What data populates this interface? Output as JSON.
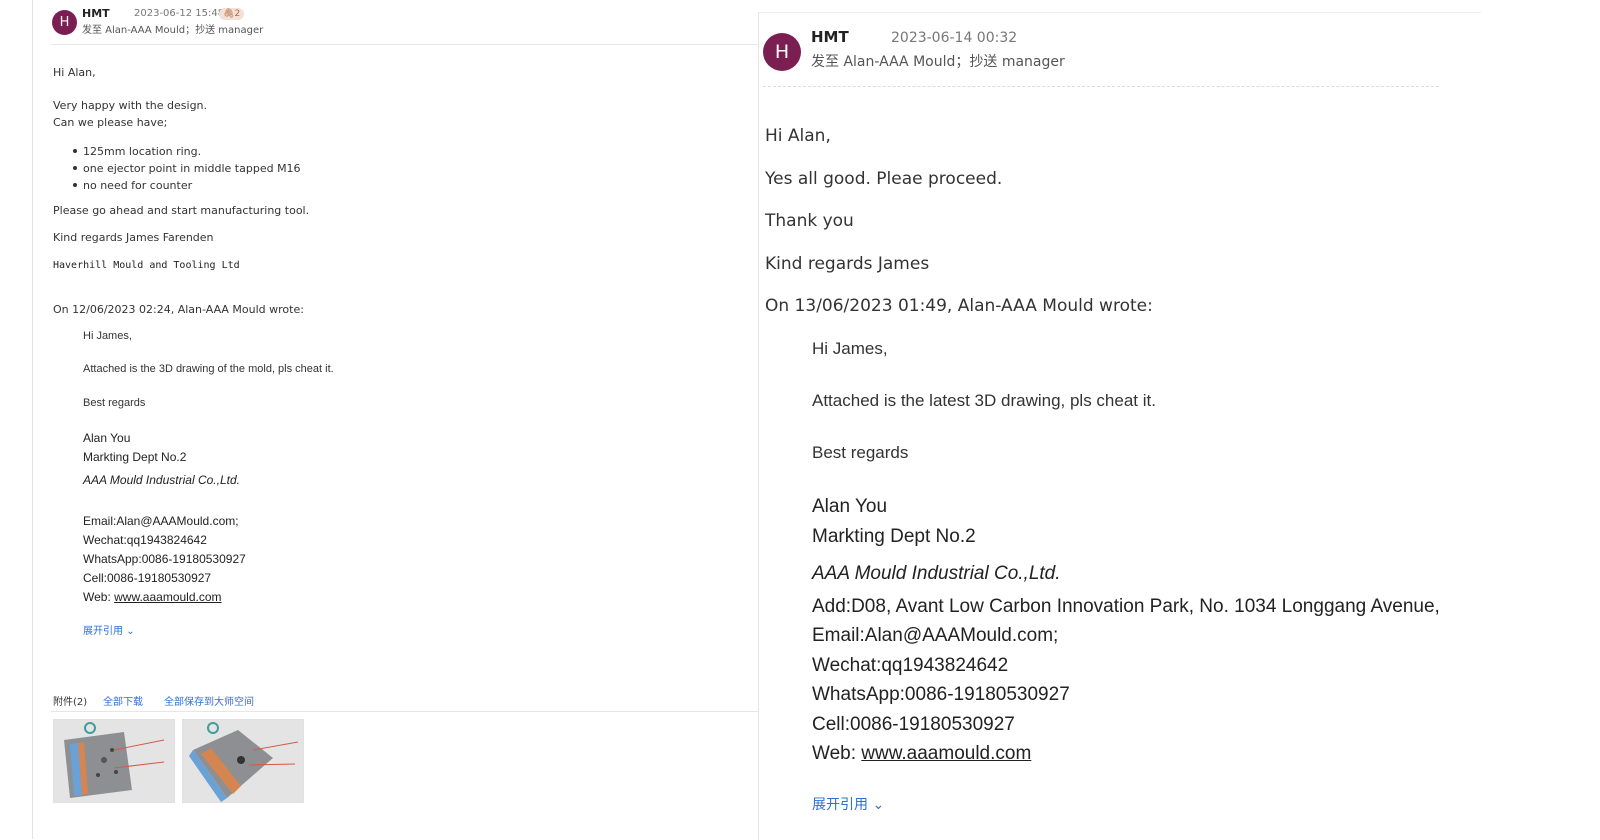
{
  "left": {
    "header": {
      "avatar_letter": "H",
      "sender": "HMT",
      "date": "2023-06-12 15:48",
      "attach_count": "2",
      "recipients": "发至 Alan-AAA Mould；抄送 manager"
    },
    "body": {
      "greeting": "Hi Alan,",
      "line1": "Very happy with the design.",
      "line2": "Can we please have;",
      "bullets": [
        "125mm location ring.",
        "one ejector point in middle tapped M16",
        "no need for counter"
      ],
      "line3": "Please go ahead and start manufacturing tool.",
      "regards": "Kind regards James Farenden",
      "company": "Haverhill Mould and Tooling Ltd",
      "quote_header": "On 12/06/2023 02:24, Alan-AAA Mould wrote:"
    },
    "quote": {
      "greeting": "Hi James,",
      "line1": "Attached is the 3D drawing of the mold, pls cheat it.",
      "best": "Best regards",
      "name": "Alan You",
      "dept": "Markting Dept No.2",
      "company": "AAA Mould Industrial Co.,Ltd.",
      "email": "Email:Alan@AAAMould.com;",
      "wechat": "Wechat:qq1943824642",
      "whatsapp": "WhatsApp:0086-19180530927",
      "cell": "Cell:0086-19180530927",
      "web_prefix": "Web: ",
      "web_link": "www.aaamould.com"
    },
    "expand_quote": "展开引用",
    "attachments": {
      "label": "附件(2)",
      "download_all": "全部下载",
      "save_all": "全部保存到大师空间"
    }
  },
  "right": {
    "header": {
      "avatar_letter": "H",
      "sender": "HMT",
      "date": "2023-06-14 00:32",
      "recipients": "发至 Alan-AAA Mould；抄送 manager"
    },
    "body": {
      "greeting": "Hi Alan,",
      "line1": "Yes all good. Pleae proceed.",
      "thanks": "Thank you",
      "regards": "Kind regards James",
      "quote_header": "On 13/06/2023 01:49, Alan-AAA Mould wrote:"
    },
    "quote": {
      "greeting": "Hi James,",
      "line1": "Attached is the latest 3D drawing, pls cheat it.",
      "best": "Best regards",
      "name": "Alan You",
      "dept": "Markting Dept No.2",
      "company": "AAA Mould Industrial Co.,Ltd.",
      "address": "Add:D08, Avant Low Carbon Innovation Park, No. 1034 Longgang Avenue,",
      "email": "Email:Alan@AAAMould.com;",
      "wechat": "Wechat:qq1943824642",
      "whatsapp": "WhatsApp:0086-19180530927",
      "cell": "Cell:0086-19180530927",
      "web_prefix": "Web: ",
      "web_link": "www.aaamould.com"
    },
    "expand_quote": "展开引用"
  }
}
